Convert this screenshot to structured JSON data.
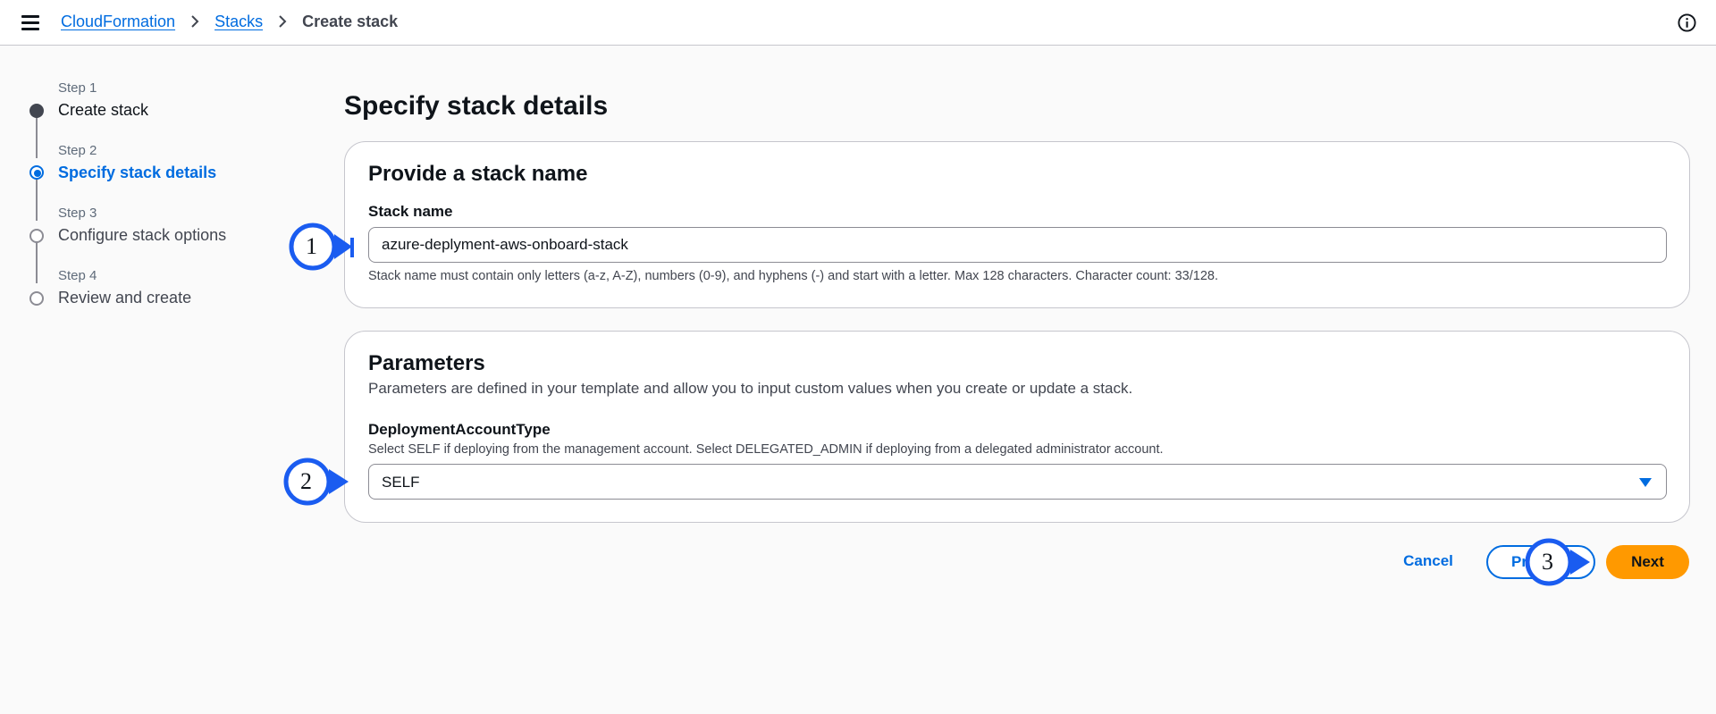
{
  "header": {
    "breadcrumbs": [
      "CloudFormation",
      "Stacks"
    ],
    "current": "Create stack"
  },
  "steps": [
    {
      "num": "Step 1",
      "title": "Create stack",
      "state": "done"
    },
    {
      "num": "Step 2",
      "title": "Specify stack details",
      "state": "active"
    },
    {
      "num": "Step 3",
      "title": "Configure stack options",
      "state": "todo"
    },
    {
      "num": "Step 4",
      "title": "Review and create",
      "state": "todo"
    }
  ],
  "page": {
    "title": "Specify stack details"
  },
  "stack_name_panel": {
    "heading": "Provide a stack name",
    "label": "Stack name",
    "value": "azure-deplyment-aws-onboard-stack",
    "help": "Stack name must contain only letters (a-z, A-Z), numbers (0-9), and hyphens (-) and start with a letter. Max 128 characters. Character count: 33/128."
  },
  "parameters_panel": {
    "heading": "Parameters",
    "description": "Parameters are defined in your template and allow you to input custom values when you create or update a stack.",
    "param_label": "DeploymentAccountType",
    "param_help": "Select SELF if deploying from the management account. Select DELEGATED_ADMIN if deploying from a delegated administrator account.",
    "selected": "SELF"
  },
  "actions": {
    "cancel": "Cancel",
    "previous_visible": "Pr",
    "next": "Next"
  },
  "annotations": [
    "1",
    "2",
    "3"
  ],
  "colors": {
    "link": "#006ce0",
    "primary_button": "#ff9900",
    "annotation": "#1a5cf0"
  }
}
